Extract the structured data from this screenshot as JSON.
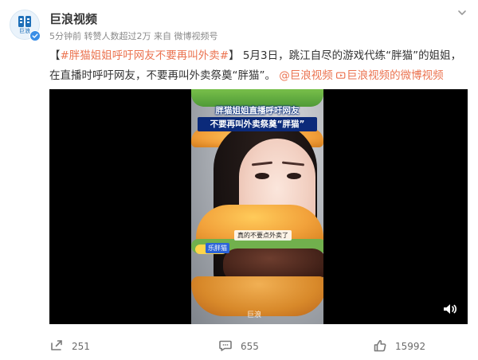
{
  "post": {
    "author": "巨浪视频",
    "meta": "5分钟前  转赞人数超过2万  来自 微博视频号",
    "avatar_text": "巨浪",
    "text": {
      "bracket_left": "【",
      "topic": "#胖猫姐姐呼吁网友不要再叫外卖#",
      "bracket_right": "】",
      "body_1": "5月3日，跳江自尽的游戏代练“胖猫”的姐姐，在直播时呼吁网友，不要再叫外卖祭奠“胖猫”。",
      "mention": "@巨浪视频",
      "link_text": "巨浪视频的微博视频"
    }
  },
  "video": {
    "caption_line1": "胖猫姐姐直播呼吁网友",
    "caption_line2_prefix": "不要再叫外卖祭奠",
    "caption_line2_quote": "“胖猫”",
    "bubble_text": "真的不要点外卖了",
    "sticker_text": "乐胖猫",
    "watermark": "巨浪"
  },
  "actions": {
    "repost_count": "251",
    "comment_count": "655",
    "like_count": "15992"
  },
  "colors": {
    "accent": "#eb7350",
    "text": "#333333",
    "muted": "#8a8a8a",
    "verified": "#3a8ee6"
  },
  "icons": {
    "more": "chevron-down-icon",
    "verified": "verified-badge-icon",
    "mention": "at-icon",
    "video_link": "video-link-icon",
    "volume": "volume-icon",
    "repost": "repost-icon",
    "comment": "comment-icon",
    "like": "like-icon"
  }
}
